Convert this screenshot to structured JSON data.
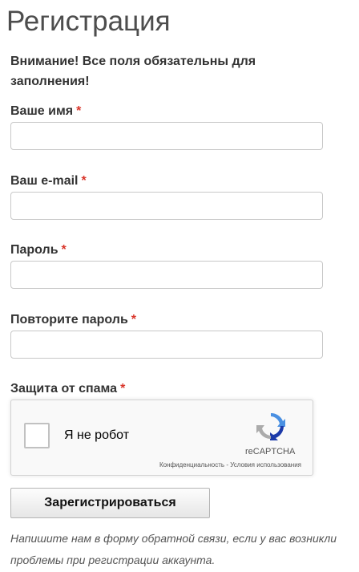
{
  "page": {
    "title": "Регистрация",
    "notice": "Внимание! Все поля обязательны для заполнения!",
    "required_mark": "*"
  },
  "form": {
    "fields": [
      {
        "label": "Ваше имя",
        "value": ""
      },
      {
        "label": "Ваш e-mail",
        "value": ""
      },
      {
        "label": "Пароль",
        "value": ""
      },
      {
        "label": "Повторите пароль",
        "value": ""
      }
    ],
    "spam_label": "Защита от спама",
    "recaptcha": {
      "checkbox_label": "Я не робот",
      "checked": false,
      "brand": "reCAPTCHA",
      "privacy": "Конфиденциальность",
      "separator": " - ",
      "terms": "Условия использования"
    },
    "submit_label": "Зарегистрироваться"
  },
  "footer": {
    "note": "Напишите нам в форму обратной связи, если у вас возникли проблемы при регистрации аккаунта."
  },
  "colors": {
    "required": "#d9362b",
    "title": "#4d4d4d"
  }
}
